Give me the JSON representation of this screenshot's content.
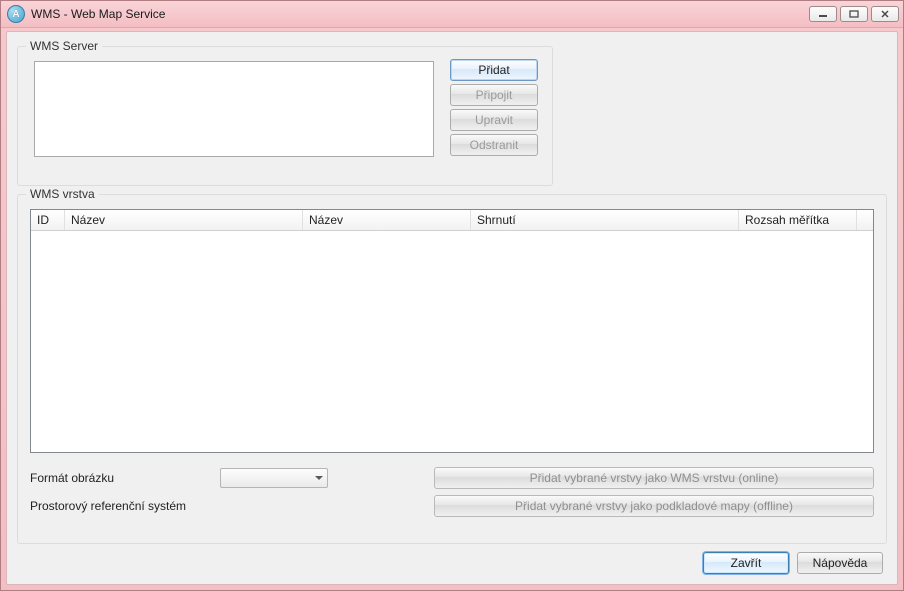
{
  "window": {
    "title": "WMS - Web Map Service",
    "icon_letter": "A"
  },
  "server_group": {
    "label": "WMS Server",
    "buttons": {
      "add": "Přidat",
      "connect": "Připojit",
      "edit": "Upravit",
      "remove": "Odstranit"
    }
  },
  "layer_group": {
    "label": "WMS vrstva",
    "columns": {
      "id": "ID",
      "name1": "Název",
      "name2": "Název",
      "summary": "Shrnutí",
      "scale": "Rozsah měřítka"
    },
    "format_label": "Formát obrázku",
    "srs_label": "Prostorový referenční systém",
    "add_online": "Přidat vybrané vrstvy jako WMS vrstvu (online)",
    "add_offline": "Přidat vybrané vrstvy jako podkladové mapy (offline)"
  },
  "footer": {
    "close": "Zavřít",
    "help": "Nápověda"
  }
}
